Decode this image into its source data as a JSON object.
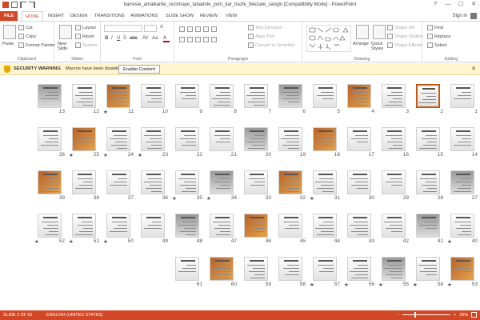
{
  "window": {
    "title": "barresie_amalkarde_rezinhaye_tabadole_yoni_dar_hazfe_felezate_sangin [Compatibility Mode] - PowerPoint",
    "controls": [
      "?",
      "—",
      "☐",
      "✕"
    ]
  },
  "ribbon_tabs": [
    "FILE",
    "HOME",
    "INSERT",
    "DESIGN",
    "TRANSITIONS",
    "ANIMATIONS",
    "SLIDE SHOW",
    "REVIEW",
    "VIEW"
  ],
  "active_tab": "HOME",
  "account": {
    "label": "Sign in"
  },
  "ribbon": {
    "clipboard": {
      "paste": "Paste",
      "cut": "Cut",
      "copy": "Copy",
      "format_painter": "Format Painter",
      "label": "Clipboard"
    },
    "slides": {
      "new_slide": "New Slide",
      "layout": "Layout",
      "reset": "Reset",
      "section": "Section",
      "label": "Slides"
    },
    "font": {
      "label": "Font",
      "clear": "A",
      "format_buttons": [
        "B",
        "I",
        "U",
        "S",
        "abc",
        "AV",
        "Aa"
      ]
    },
    "paragraph": {
      "text_direction": "Text Direction",
      "align_text": "Align Text",
      "convert_smartart": "Convert to SmartArt",
      "label": "Paragraph"
    },
    "drawing": {
      "arrange": "Arrange",
      "quick_styles": "Quick Styles",
      "shape_fill": "Shape Fill",
      "shape_outline": "Shape Outline",
      "shape_effects": "Shape Effects",
      "label": "Drawing"
    },
    "editing": {
      "find": "Find",
      "replace": "Replace",
      "select": "Select",
      "label": "Editing"
    }
  },
  "security_bar": {
    "title": "SECURITY WARNING",
    "message": "Macros have been disabled.",
    "button": "Enable Content",
    "close": "✕"
  },
  "slides": [
    {
      "n": "1"
    },
    {
      "n": "2",
      "selected": true
    },
    {
      "n": "3"
    },
    {
      "n": "4"
    },
    {
      "n": "5"
    },
    {
      "n": "6"
    },
    {
      "n": "7"
    },
    {
      "n": "8"
    },
    {
      "n": "9"
    },
    {
      "n": "10"
    },
    {
      "n": "11",
      "star": true
    },
    {
      "n": "12"
    },
    {
      "n": "13"
    },
    {
      "n": "14"
    },
    {
      "n": "15"
    },
    {
      "n": "16"
    },
    {
      "n": "17"
    },
    {
      "n": "18"
    },
    {
      "n": "19"
    },
    {
      "n": "20"
    },
    {
      "n": "21"
    },
    {
      "n": "22"
    },
    {
      "n": "23",
      "star": true
    },
    {
      "n": "24",
      "star": true
    },
    {
      "n": "25",
      "star": true
    },
    {
      "n": "26"
    },
    {
      "n": "27"
    },
    {
      "n": "28"
    },
    {
      "n": "29"
    },
    {
      "n": "30"
    },
    {
      "n": "31",
      "star": true
    },
    {
      "n": "32"
    },
    {
      "n": "33"
    },
    {
      "n": "34",
      "star": true
    },
    {
      "n": "35",
      "star": true
    },
    {
      "n": "36"
    },
    {
      "n": "37"
    },
    {
      "n": "38"
    },
    {
      "n": "39"
    },
    {
      "n": "40",
      "star": true
    },
    {
      "n": "41"
    },
    {
      "n": "42"
    },
    {
      "n": "43"
    },
    {
      "n": "44"
    },
    {
      "n": "45"
    },
    {
      "n": "46"
    },
    {
      "n": "47"
    },
    {
      "n": "48"
    },
    {
      "n": "49"
    },
    {
      "n": "50",
      "star": true
    },
    {
      "n": "51",
      "star": true
    },
    {
      "n": "52",
      "star": true
    },
    {
      "n": "53",
      "star": true
    },
    {
      "n": "54",
      "star": true
    },
    {
      "n": "55",
      "star": true
    },
    {
      "n": "56",
      "star": true
    },
    {
      "n": "57",
      "star": true
    },
    {
      "n": "58"
    },
    {
      "n": "59"
    },
    {
      "n": "60"
    },
    {
      "n": "61"
    }
  ],
  "status_bar": {
    "slide_info": "SLIDE 2 OF 61",
    "language": "ENGLISH (UNITED STATES)",
    "zoom": "26%",
    "zoom_fraction": 0.26
  },
  "colors": {
    "accent": "#d24726",
    "selection": "#c55a11",
    "warning_bg": "#fff4ce"
  }
}
